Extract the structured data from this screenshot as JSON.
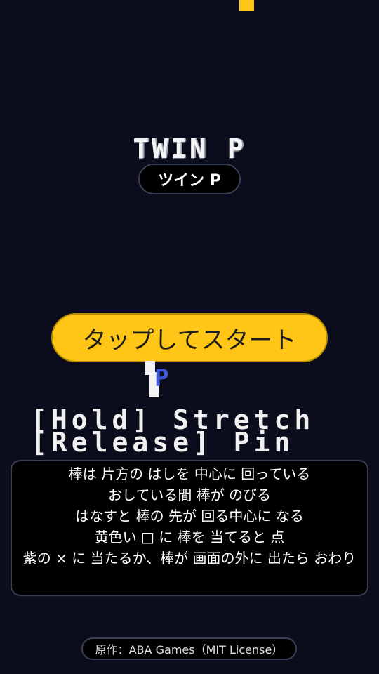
{
  "colors": {
    "background": "#0b0d1c",
    "accent_yellow": "#ffc617",
    "stick_white": "#f2f2f2",
    "pin_blue": "#4058d8"
  },
  "title": "TWIN P",
  "subtitle": "ツイン P",
  "start_button_label": "タップしてスタート",
  "pin_marker": "P",
  "controls": {
    "hold": "[Hold] Stretch",
    "release": "[Release] Pin"
  },
  "instructions": [
    "棒は 片方の はしを 中心に 回っている",
    "おしている間 棒が のびる",
    "はなすと 棒の 先が 回る中心に なる",
    "黄色い □ に 棒を 当てると 点",
    "紫の × に 当たるか、棒が 画面の外に 出たら おわり"
  ],
  "credit": "原作：ABA Games（MIT License）"
}
